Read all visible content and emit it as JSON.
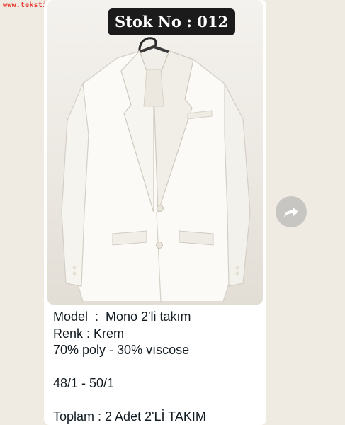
{
  "watermark": "www.tekstilportal.com",
  "message": {
    "image": {
      "badge": "Stok No : 012",
      "subject": "white-two-piece-suit-jacket"
    },
    "caption": {
      "line1": "Model  :  Mono 2'li takım",
      "line2": "Renk : Krem",
      "line3": "70% poly - 30% vıscose",
      "line4": "48/1 - 50/1",
      "line5": "Toplam : 2 Adet 2'Lİ TAKIM"
    }
  },
  "forward_button": {
    "icon": "forward-arrow-icon"
  },
  "colors": {
    "chat_background": "#efeae2",
    "bubble": "#ffffff",
    "badge_bg": "#1b1b1b",
    "forward_button": "#c8c6c2",
    "watermark": "#e63b2e"
  }
}
